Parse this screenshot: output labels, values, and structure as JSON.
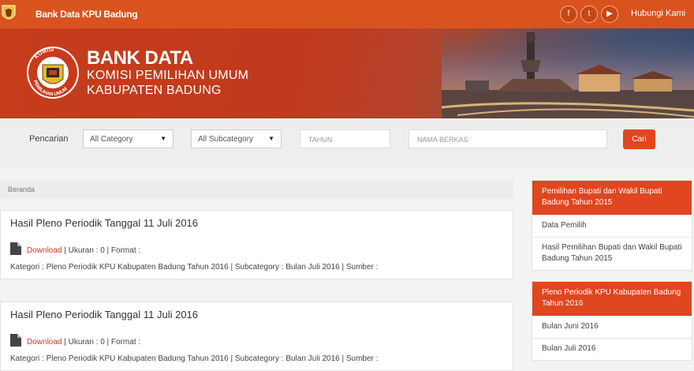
{
  "header": {
    "site_name": "Bank Data KPU Badung",
    "contact": "Hubungi Kami",
    "social_icons": [
      "facebook-icon",
      "twitter-icon",
      "youtube-icon"
    ]
  },
  "banner": {
    "emblem_text": "KOMISI PEMILIHAN UMUM",
    "title_line1": "BANK DATA",
    "title_line2": "KOMISI PEMILIHAN UMUM",
    "title_line3": "KABUPATEN BADUNG"
  },
  "search": {
    "label": "Pencarian",
    "category": "All Category",
    "subcategory": "All Subcategory",
    "year_placeholder": "TAHUN",
    "filename_placeholder": "NAMA BERKAS",
    "submit": "Cari"
  },
  "breadcrumb": "Beranda",
  "results": [
    {
      "title": "Hasil Pleno Periodik Tanggal 11 Juli 2016",
      "download": "Download",
      "size": " | Ukuran : 0 | Format : ",
      "category": "Kategori : Pleno Periodik KPU Kabupaten Badung Tahun 2016 | Subcategory : Bulan Juli 2016 | Sumber :"
    },
    {
      "title": "Hasil Pleno Periodik Tanggal 11 Juli 2016",
      "download": "Download",
      "size": " | Ukuran : 0 | Format : ",
      "category": "Kategori : Pleno Periodik KPU Kabupaten Badung Tahun 2016 | Subcategory : Bulan Juli 2016 | Sumber :"
    }
  ],
  "sidebar": [
    {
      "heading": "Pemilihan Bupati dan Wakil Bupati Badung Tahun 2015",
      "items": [
        "Data Pemilih",
        "Hasil Pemilihan Bupati dan Wakil Bupati Badung Tahun 2015"
      ]
    },
    {
      "heading": "Pleno Periodik KPU Kabupaten Badung Tahun 2016",
      "items": [
        "Bulan Juni 2016",
        "Bulan Juli 2016"
      ]
    }
  ],
  "colors": {
    "brand": "#d9531e",
    "accent": "#e0461f"
  }
}
